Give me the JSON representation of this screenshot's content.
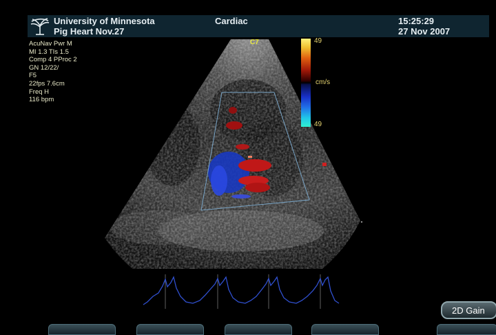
{
  "header": {
    "institution": "University of Minnesota",
    "study": "Pig Heart  Nov.27",
    "preset": "Cardiac",
    "time": "15:25:29",
    "date": "27 Nov 2007"
  },
  "params": [
    "AcuNav  Pwr M",
    "MI 1.3  TIs 1.5",
    "Comp 4  PProc 2",
    "GN  12/22/",
    "F5",
    "22fps    7.6cm",
    "Freq H",
    "116 bpm"
  ],
  "colorbar": {
    "top_value": "49",
    "unit": "cm/s",
    "bottom_value": "49"
  },
  "orientation_marker": "C7",
  "gain_button": "2D Gain",
  "colors": {
    "header_bg": "#0f2530",
    "ecg_trace": "#3050d0",
    "roi_box": "#7aa6c8"
  },
  "icons": [
    "tree-logo-icon"
  ]
}
